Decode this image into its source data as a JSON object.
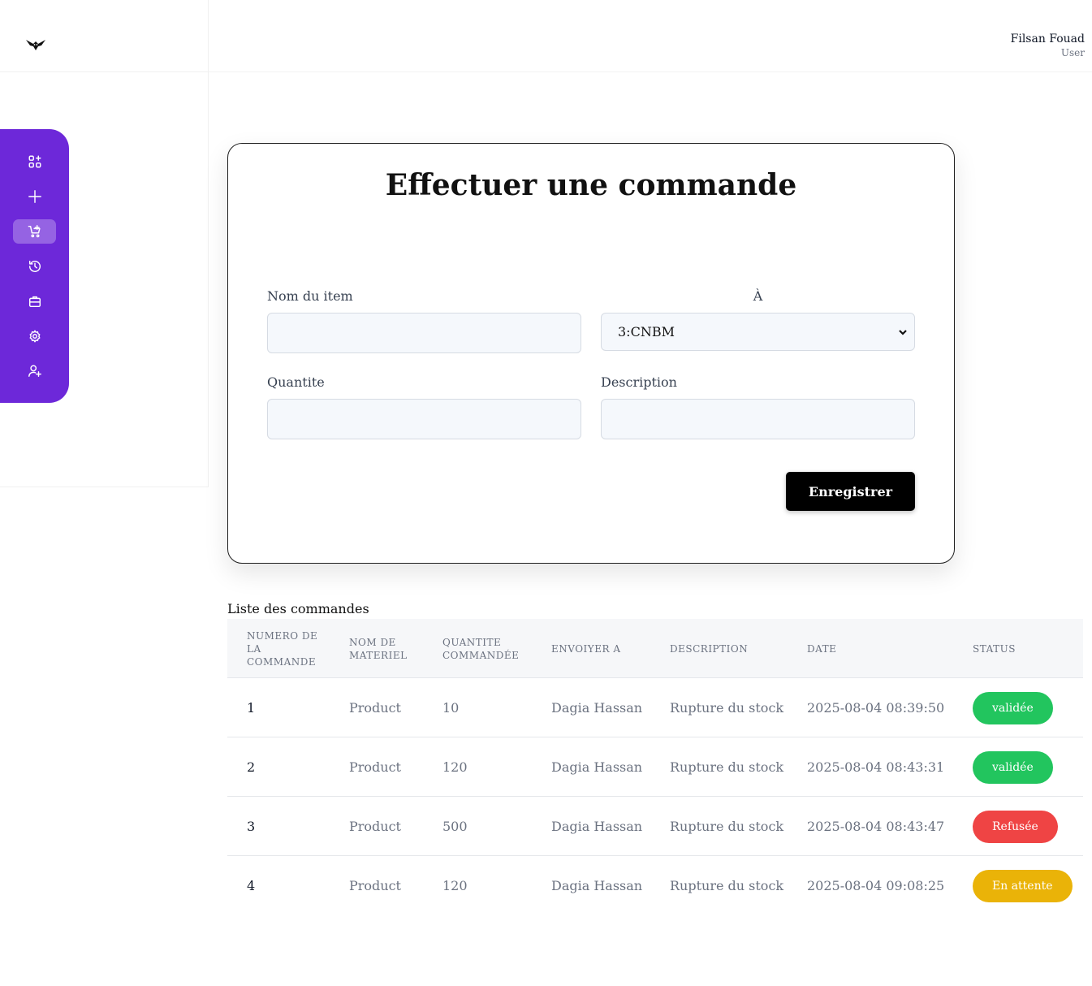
{
  "header": {
    "user_name": "Filsan Fouad",
    "user_role": "User"
  },
  "sidebar": {
    "items": [
      {
        "icon": "dashboard-add-icon",
        "active": false
      },
      {
        "icon": "plus-icon",
        "active": false
      },
      {
        "icon": "cart-icon",
        "active": true
      },
      {
        "icon": "history-icon",
        "active": false
      },
      {
        "icon": "briefcase-icon",
        "active": false
      },
      {
        "icon": "settings-icon",
        "active": false
      },
      {
        "icon": "user-add-icon",
        "active": false
      }
    ]
  },
  "form": {
    "title": "Effectuer une commande",
    "item_name_label": "Nom du item",
    "item_name_value": "",
    "to_label": "À",
    "to_selected": "3:CNBM",
    "quantity_label": "Quantite",
    "quantity_value": "",
    "description_label": "Description",
    "description_value": "",
    "save_label": "Enregistrer"
  },
  "orders": {
    "title": "Liste des commandes",
    "columns": [
      "NUMERO DE LA COMMANDE",
      "NOM DE MATERIEL",
      "QUANTITE COMMANDÉE",
      "ENVOIYER A",
      "DESCRIPTION",
      "DATE",
      "STATUS"
    ],
    "rows": [
      {
        "number": "1",
        "material": "Product",
        "quantity": "10",
        "sent_to": "Dagia Hassan",
        "description": "Rupture du stock",
        "date": "2025-08-04 08:39:50",
        "status": "validée"
      },
      {
        "number": "2",
        "material": "Product",
        "quantity": "120",
        "sent_to": "Dagia Hassan",
        "description": "Rupture du stock",
        "date": "2025-08-04 08:43:31",
        "status": "validée"
      },
      {
        "number": "3",
        "material": "Product",
        "quantity": "500",
        "sent_to": "Dagia Hassan",
        "description": "Rupture du stock",
        "date": "2025-08-04 08:43:47",
        "status": "Refusée"
      },
      {
        "number": "4",
        "material": "Product",
        "quantity": "120",
        "sent_to": "Dagia Hassan",
        "description": "Rupture du stock",
        "date": "2025-08-04 09:08:25",
        "status": "En attente"
      }
    ]
  },
  "colors": {
    "sidebar": "#6d28d9",
    "validated": "#22c55e",
    "refused": "#ef4444",
    "pending": "#eab308"
  }
}
